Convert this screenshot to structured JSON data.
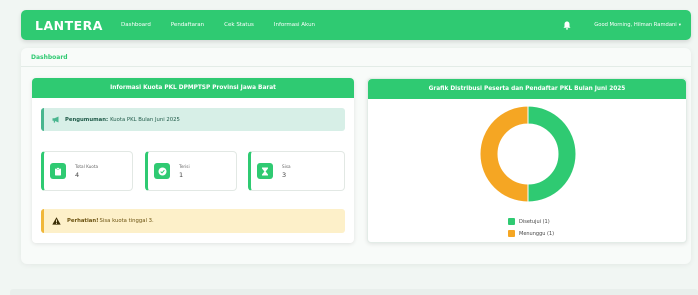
{
  "navbar": {
    "brand": "LANTERA",
    "links": [
      "Dashboard",
      "Pendaftaran",
      "Cek Status",
      "Informasi Akun"
    ],
    "greeting": "Good Morning, Hilman Ramdani",
    "caret": "▾",
    "color": "#2fca72"
  },
  "breadcrumb": "Dashboard",
  "left_panel": {
    "title": "Informasi Kuota PKL DPMPTSP Provinsi Jawa Barat",
    "announcement": {
      "label": "Pengumuman:",
      "text": "Kuota PKL Bulan Juni 2025"
    },
    "stats": [
      {
        "label": "Total Kuota",
        "value": "4",
        "icon": "clipboard-icon"
      },
      {
        "label": "Terisi",
        "value": "1",
        "icon": "check-circle-icon"
      },
      {
        "label": "Sisa",
        "value": "3",
        "icon": "hourglass-icon"
      }
    ],
    "warning": {
      "label": "Perhatian!",
      "text": "Sisa kuota tinggal 3."
    }
  },
  "right_panel": {
    "title": "Grafik Distribusi Peserta dan Pendaftar PKL Bulan Juni 2025"
  },
  "chart_data": {
    "type": "pie",
    "categories": [
      "Disetujui",
      "Menunggu"
    ],
    "values": [
      1,
      1
    ],
    "colors": [
      "#2fca72",
      "#f5a623"
    ],
    "legend": [
      "Disetujui (1)",
      "Menunggu (1)"
    ],
    "legend_position": "bottom"
  }
}
